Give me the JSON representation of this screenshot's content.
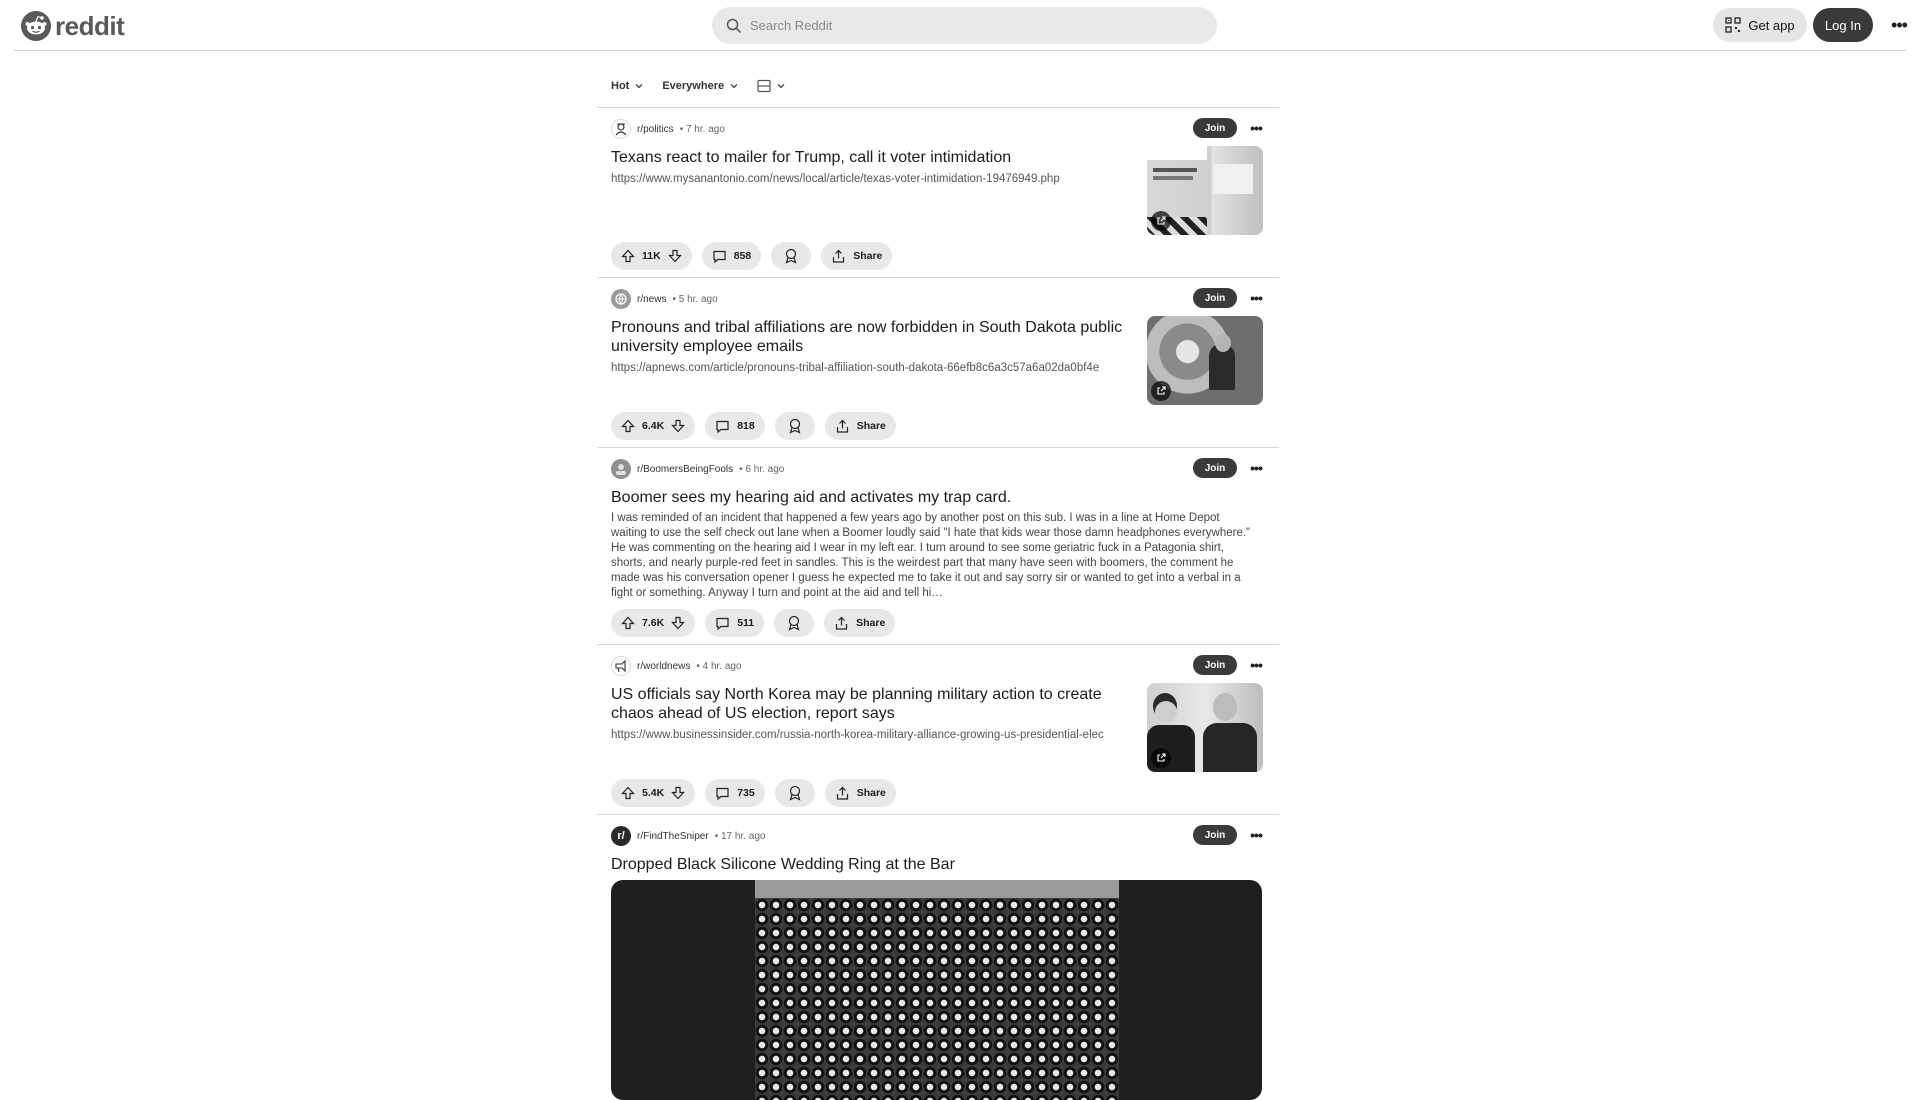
{
  "header": {
    "logo_text": "reddit",
    "search_placeholder": "Search Reddit",
    "get_app_label": "Get app",
    "login_label": "Log In",
    "more_label": "•••"
  },
  "sortbar": {
    "sort_label": "Hot",
    "location_label": "Everywhere"
  },
  "posts": [
    {
      "subreddit": "r/politics",
      "time": "• 7 hr. ago",
      "join": "Join",
      "title": "Texans react to mailer for Trump, call it voter intimidation",
      "link": "https://www.mysanantonio.com/news/local/article/texas-voter-intimidation-19476949.php",
      "upvotes": "11K",
      "comments": "858",
      "share": "Share"
    },
    {
      "subreddit": "r/news",
      "time": "• 5 hr. ago",
      "join": "Join",
      "title": "Pronouns and tribal affiliations are now forbidden in South Dakota public university employee emails",
      "link": "https://apnews.com/article/pronouns-tribal-affiliation-south-dakota-66efb8c6a3c57a6a02da0bf4e",
      "upvotes": "6.4K",
      "comments": "818",
      "share": "Share"
    },
    {
      "subreddit": "r/BoomersBeingFools",
      "time": "• 6 hr. ago",
      "join": "Join",
      "title": "Boomer sees my hearing aid and activates my trap card.",
      "body": "I was reminded of an incident that happened a few years ago by another post on this sub. I was in a line at Home Depot waiting to use the self check out lane when a Boomer loudly said \"I hate that kids wear those damn headphones everywhere.\" He was commenting on the hearing aid I wear in my left ear. I turn around to see some geriatric fuck in a Patagonia shirt, shorts, and nearly purple-red feet in sandles. This is the weirdest part that many have seen with boomers, the comment he made was his conversation opener I guess he expected me to take it out and say sorry sir or wanted to get into a verbal in a fight or something. Anyway I turn and point at the aid and tell hi…",
      "upvotes": "7.6K",
      "comments": "511",
      "share": "Share"
    },
    {
      "subreddit": "r/worldnews",
      "time": "• 4 hr. ago",
      "join": "Join",
      "title": "US officials say North Korea may be planning military action to create chaos ahead of US election, report says",
      "link": "https://www.businessinsider.com/russia-north-korea-military-alliance-growing-us-presidential-elec",
      "upvotes": "5.4K",
      "comments": "735",
      "share": "Share"
    },
    {
      "subreddit": "r/FindTheSniper",
      "time": "• 17 hr. ago",
      "join": "Join",
      "title": "Dropped Black Silicone Wedding Ring at the Bar"
    }
  ]
}
